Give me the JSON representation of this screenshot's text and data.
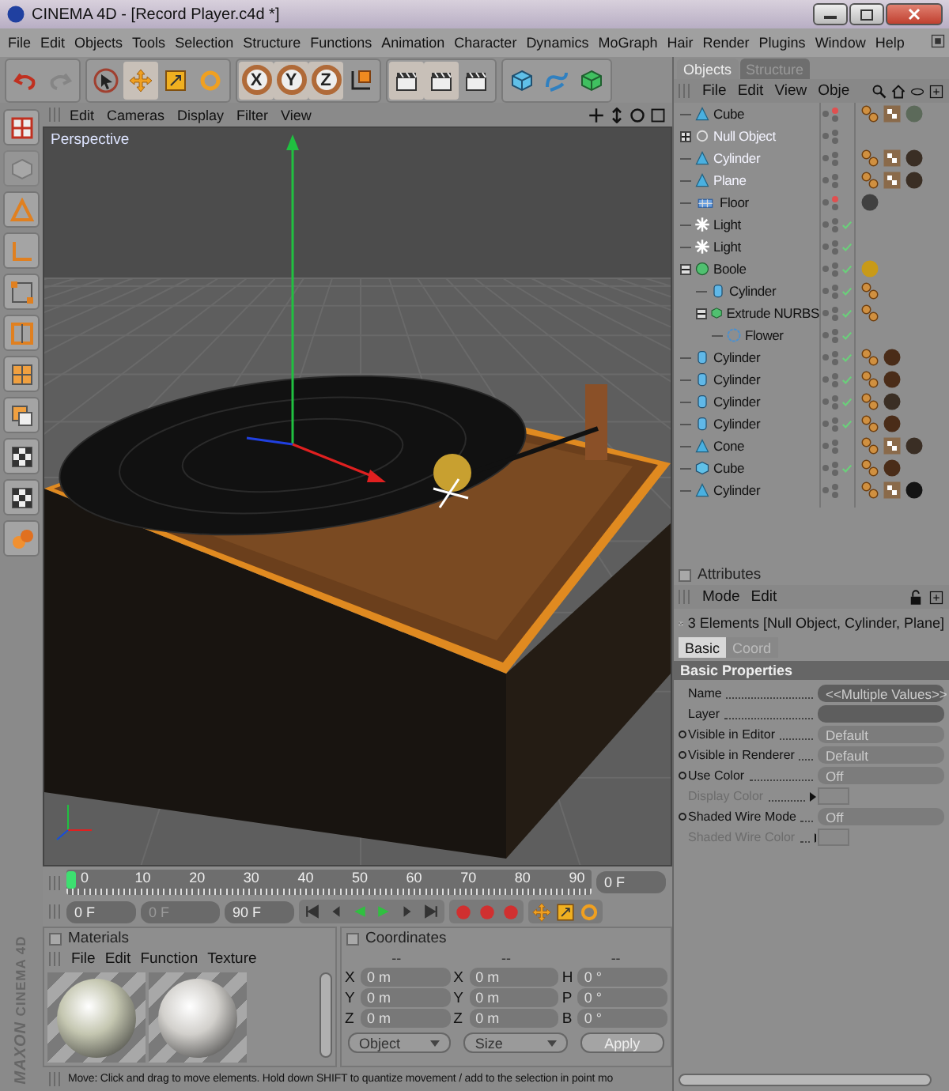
{
  "window": {
    "title": "CINEMA 4D - [Record Player.c4d *]"
  },
  "menu": [
    "File",
    "Edit",
    "Objects",
    "Tools",
    "Selection",
    "Structure",
    "Functions",
    "Animation",
    "Character",
    "Dynamics",
    "MoGraph",
    "Hair",
    "Render",
    "Plugins",
    "Window",
    "Help"
  ],
  "toolbar": [
    [
      {
        "kind": "undo",
        "disabled": false,
        "selected": false
      },
      {
        "kind": "redo",
        "disabled": true,
        "selected": false
      }
    ],
    [
      {
        "kind": "select",
        "disabled": false,
        "selected": false
      },
      {
        "kind": "move",
        "disabled": false,
        "selected": true
      },
      {
        "kind": "scale",
        "disabled": false,
        "selected": false
      },
      {
        "kind": "rotate",
        "disabled": false,
        "selected": false
      }
    ],
    [
      {
        "kind": "axis",
        "label": "X",
        "disabled": false,
        "selected": true
      },
      {
        "kind": "axis",
        "label": "Y",
        "disabled": false,
        "selected": true
      },
      {
        "kind": "axis",
        "label": "Z",
        "disabled": false,
        "selected": true
      },
      {
        "kind": "coords",
        "disabled": false,
        "selected": false
      }
    ],
    [
      {
        "kind": "render",
        "disabled": false,
        "selected": true
      },
      {
        "kind": "render",
        "disabled": false,
        "selected": true
      },
      {
        "kind": "render",
        "disabled": false,
        "selected": false
      }
    ],
    [
      {
        "kind": "cube",
        "disabled": false,
        "selected": false
      },
      {
        "kind": "spline",
        "disabled": false,
        "selected": false
      },
      {
        "kind": "nurbs",
        "disabled": false,
        "selected": false
      }
    ]
  ],
  "left_tools": [
    {
      "kind": "layout",
      "disabled": false
    },
    {
      "kind": "editable",
      "disabled": true
    },
    {
      "kind": "model",
      "disabled": false
    },
    {
      "kind": "object",
      "disabled": false
    },
    {
      "kind": "points",
      "disabled": false
    },
    {
      "kind": "edges",
      "disabled": false
    },
    {
      "kind": "polygons",
      "disabled": false
    },
    {
      "kind": "texture",
      "disabled": false
    },
    {
      "kind": "checker",
      "disabled": false
    },
    {
      "kind": "checker",
      "disabled": false
    },
    {
      "kind": "sculpt",
      "disabled": false
    }
  ],
  "logo": {
    "line_1": "MAXON",
    "line_2": "CINEMA 4D"
  },
  "viewport": {
    "menu": [
      "Edit",
      "Cameras",
      "Display",
      "Filter",
      "View"
    ],
    "camera": "Perspective"
  },
  "timeline": {
    "ticks": [
      "0",
      "10",
      "20",
      "30",
      "40",
      "50",
      "60",
      "70",
      "80",
      "90"
    ],
    "level": 0,
    "current": "0 F",
    "start": "0 F",
    "preview": "0 F",
    "end": "90 F"
  },
  "materials": {
    "title": "Materials",
    "menu": [
      "File",
      "Edit",
      "Function",
      "Texture"
    ],
    "items": [
      {
        "color": "#c4c6b0"
      },
      {
        "color": "#d2d0cc"
      }
    ]
  },
  "coordinates": {
    "title": "Coordinates",
    "headers": [
      "--",
      "--",
      "--"
    ],
    "columns": [
      [
        {
          "axis": "X",
          "value": "0 m"
        },
        {
          "axis": "Y",
          "value": "0 m"
        },
        {
          "axis": "Z",
          "value": "0 m"
        }
      ],
      [
        {
          "axis": "X",
          "value": "0 m"
        },
        {
          "axis": "Y",
          "value": "0 m"
        },
        {
          "axis": "Z",
          "value": "0 m"
        }
      ],
      [
        {
          "axis": "H",
          "value": "0 °"
        },
        {
          "axis": "P",
          "value": "0 °"
        },
        {
          "axis": "B",
          "value": "0 °"
        }
      ]
    ],
    "mode": "Object",
    "size": "Size",
    "apply": "Apply"
  },
  "status_bar": "Move: Click and drag to move elements. Hold down SHIFT to quantize movement / add to the selection in point mo",
  "objects": {
    "tabs": [
      {
        "label": "Objects",
        "selected": true
      },
      {
        "label": "Structure",
        "selected": false
      }
    ],
    "menu": [
      "File",
      "Edit",
      "View",
      "Obje"
    ],
    "tree": [
      {
        "name": "Cube",
        "kind": "polygon",
        "selected": false,
        "editor_hidden": true,
        "checked": false,
        "tags": [
          {
            "kind": "phong"
          },
          {
            "kind": "uvw"
          },
          {
            "kind": "material",
            "color": "#5c6a5a"
          }
        ]
      },
      {
        "name": "Null Object",
        "kind": "null",
        "selected": true,
        "editor_hidden": false,
        "checked": false,
        "expanded": false
      },
      {
        "name": "Cylinder",
        "kind": "polygon",
        "selected": true,
        "editor_hidden": false,
        "checked": false,
        "tags": [
          {
            "kind": "phong"
          },
          {
            "kind": "uvw"
          },
          {
            "kind": "material",
            "color": "#3a2e24"
          }
        ]
      },
      {
        "name": "Plane",
        "kind": "polygon",
        "selected": true,
        "editor_hidden": false,
        "checked": false,
        "tags": [
          {
            "kind": "phong"
          },
          {
            "kind": "uvw"
          },
          {
            "kind": "material",
            "color": "#3a2e24"
          }
        ]
      },
      {
        "name": "Floor",
        "kind": "floor",
        "selected": false,
        "editor_hidden": true,
        "checked": false,
        "tags": [
          {
            "kind": "material",
            "color": "#404040"
          }
        ]
      },
      {
        "name": "Light",
        "kind": "light",
        "selected": false,
        "editor_hidden": false,
        "checked": true
      },
      {
        "name": "Light",
        "kind": "light",
        "selected": false,
        "editor_hidden": false,
        "checked": true
      },
      {
        "name": "Boole",
        "kind": "boole",
        "selected": false,
        "editor_hidden": false,
        "checked": true,
        "expanded": true,
        "tags": [
          {
            "kind": "material",
            "color": "#c89a18"
          }
        ],
        "children": [
          {
            "name": "Cylinder",
            "kind": "cylinder",
            "selected": false,
            "editor_hidden": false,
            "checked": true,
            "tags": [
              {
                "kind": "phong"
              }
            ]
          },
          {
            "name": "Extrude NURBS",
            "kind": "extrude",
            "selected": false,
            "editor_hidden": false,
            "checked": true,
            "expanded": true,
            "tags": [
              {
                "kind": "phong"
              }
            ],
            "children": [
              {
                "name": "Flower",
                "kind": "spline",
                "selected": false,
                "editor_hidden": false,
                "checked": true
              }
            ]
          }
        ]
      },
      {
        "name": "Cylinder",
        "kind": "cylinder",
        "selected": false,
        "editor_hidden": false,
        "checked": true,
        "tags": [
          {
            "kind": "phong"
          },
          {
            "kind": "material",
            "color": "#4a2c18"
          }
        ]
      },
      {
        "name": "Cylinder",
        "kind": "cylinder",
        "selected": false,
        "editor_hidden": false,
        "checked": true,
        "tags": [
          {
            "kind": "phong"
          },
          {
            "kind": "material",
            "color": "#4a2c18"
          }
        ]
      },
      {
        "name": "Cylinder",
        "kind": "cylinder",
        "selected": false,
        "editor_hidden": false,
        "checked": true,
        "tags": [
          {
            "kind": "phong"
          },
          {
            "kind": "material",
            "color": "#3a2e24"
          }
        ]
      },
      {
        "name": "Cylinder",
        "kind": "cylinder",
        "selected": false,
        "editor_hidden": false,
        "checked": true,
        "tags": [
          {
            "kind": "phong"
          },
          {
            "kind": "material",
            "color": "#4a2c18"
          }
        ]
      },
      {
        "name": "Cone",
        "kind": "polygon",
        "selected": false,
        "editor_hidden": false,
        "checked": false,
        "tags": [
          {
            "kind": "phong"
          },
          {
            "kind": "uvw"
          },
          {
            "kind": "material",
            "color": "#3a2e24"
          }
        ]
      },
      {
        "name": "Cube",
        "kind": "cube",
        "selected": false,
        "editor_hidden": false,
        "checked": true,
        "tags": [
          {
            "kind": "phong"
          },
          {
            "kind": "material",
            "color": "#4a2c18"
          }
        ]
      },
      {
        "name": "Cylinder",
        "kind": "polygon",
        "selected": false,
        "editor_hidden": false,
        "checked": false,
        "tags": [
          {
            "kind": "phong"
          },
          {
            "kind": "uvw"
          },
          {
            "kind": "material",
            "color": "#141414"
          }
        ]
      }
    ]
  },
  "attributes": {
    "title": "Attributes",
    "menu": [
      "Mode",
      "Edit"
    ],
    "header": "3 Elements [Null Object, Cylinder, Plane]",
    "tabs": [
      {
        "label": "Basic",
        "selected": true
      },
      {
        "label": "Coord",
        "selected": false
      }
    ],
    "section": "Basic Properties",
    "rows": [
      {
        "label": "Name",
        "kind": "field",
        "value": "<<Multiple Values>>",
        "animatable": false,
        "disabled": false
      },
      {
        "label": "Layer",
        "kind": "field",
        "animatable": false,
        "disabled": false
      },
      {
        "label": "Visible in Editor",
        "kind": "dropdown",
        "value": "Default",
        "animatable": true,
        "disabled": false
      },
      {
        "label": "Visible in Renderer",
        "kind": "dropdown",
        "value": "Default",
        "animatable": true,
        "disabled": false
      },
      {
        "label": "Use Color",
        "kind": "dropdown",
        "value": "Off",
        "animatable": true,
        "disabled": false
      },
      {
        "label": "Display Color",
        "kind": "color",
        "animatable": false,
        "disabled": true
      },
      {
        "label": "Shaded Wire Mode",
        "kind": "dropdown",
        "value": "Off",
        "animatable": true,
        "disabled": false
      },
      {
        "label": "Shaded Wire Color",
        "kind": "color",
        "animatable": false,
        "disabled": true
      }
    ]
  }
}
